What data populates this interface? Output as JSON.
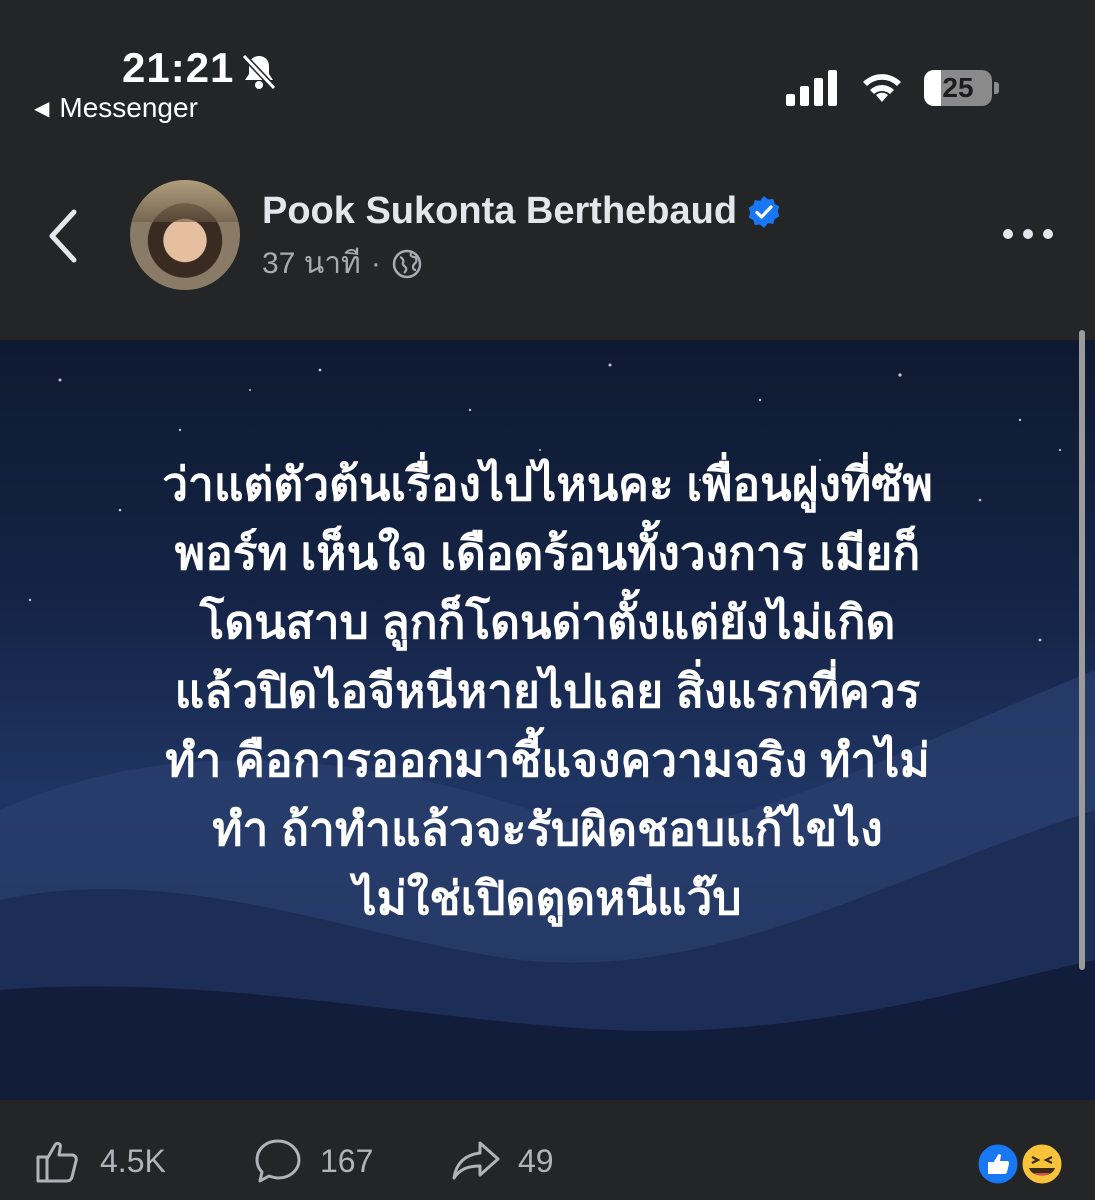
{
  "status_bar": {
    "time": "21:21",
    "back_app": "Messenger",
    "battery": "25"
  },
  "post": {
    "author": "Pook Sukonta Berthebaud",
    "time_ago": "37 นาที",
    "separator": "·",
    "text": "ว่าแต่ตัวต้นเรื่องไปไหนคะ เพื่อนฝูงที่ซัพ\nพอร์ท เห็นใจ เดือดร้อนทั้งวงการ เมียก็\nโดนสาบ ลูกก็โดนด่าตั้งแต่ยังไม่เกิด\nแล้วปิดไอจีหนีหายไปเลย สิ่งแรกที่ควร\nทำ คือการออกมาชี้แจงความจริง ทำไม่\nทำ ถ้าทำแล้วจะรับผิดชอบแก้ไขไง\nไม่ใช่เปิดตูดหนีแว๊บ"
  },
  "actions": {
    "likes": "4.5K",
    "comments": "167",
    "shares": "49"
  },
  "icons": {
    "verified": "verified-badge-icon",
    "audience": "globe-icon",
    "like": "thumbs-up-icon",
    "comment": "comment-bubble-icon",
    "share": "share-arrow-icon"
  },
  "colors": {
    "background": "#242526",
    "accent": "#1877f2",
    "text_primary": "#e4e6eb",
    "text_secondary": "#b0b3b8"
  }
}
